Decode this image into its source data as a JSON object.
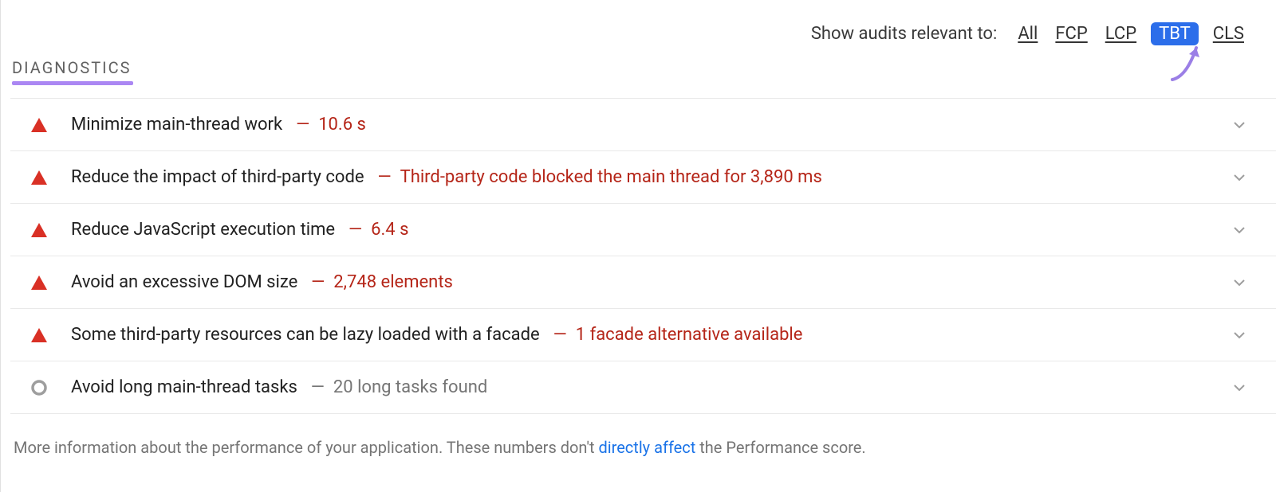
{
  "filter": {
    "label": "Show audits relevant to:",
    "items": [
      "All",
      "FCP",
      "LCP",
      "TBT",
      "CLS"
    ],
    "active_index": 3
  },
  "section_heading": "DIAGNOSTICS",
  "audits": [
    {
      "severity": "fail",
      "title": "Minimize main-thread work",
      "sep": "—",
      "detail": "10.6 s",
      "muted": false
    },
    {
      "severity": "fail",
      "title": "Reduce the impact of third-party code",
      "sep": "—",
      "detail": "Third-party code blocked the main thread for 3,890 ms",
      "muted": false
    },
    {
      "severity": "fail",
      "title": "Reduce JavaScript execution time",
      "sep": "—",
      "detail": "6.4 s",
      "muted": false
    },
    {
      "severity": "fail",
      "title": "Avoid an excessive DOM size",
      "sep": "—",
      "detail": "2,748 elements",
      "muted": false
    },
    {
      "severity": "fail",
      "title": "Some third-party resources can be lazy loaded with a facade",
      "sep": "—",
      "detail": "1 facade alternative available",
      "muted": false
    },
    {
      "severity": "info",
      "title": "Avoid long main-thread tasks",
      "sep": "—",
      "detail": "20 long tasks found",
      "muted": true
    }
  ],
  "footer": {
    "before": "More information about the performance of your application. These numbers don't ",
    "link": "directly affect",
    "after": " the Performance score."
  }
}
